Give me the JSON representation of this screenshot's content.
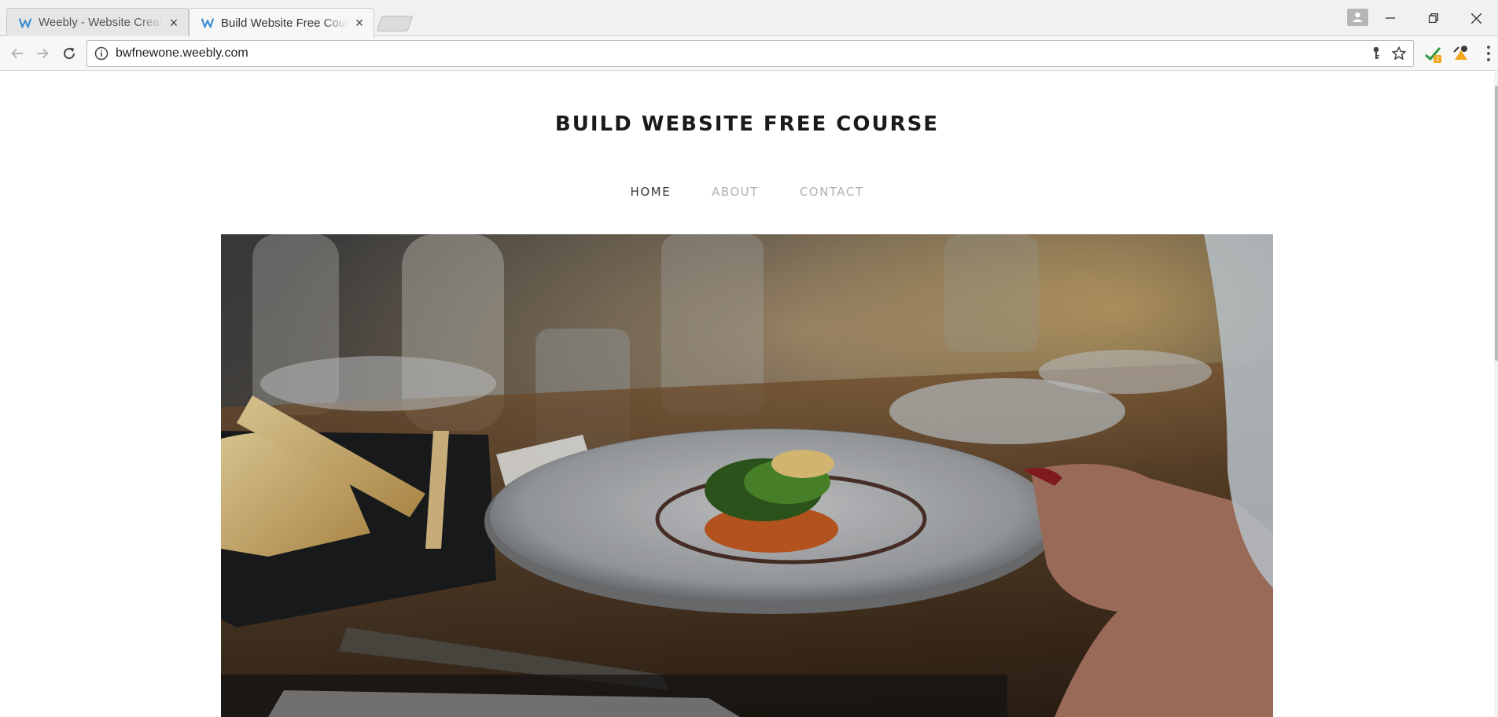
{
  "browser": {
    "tabs": [
      {
        "title": "Weebly - Website Creatio",
        "active": false
      },
      {
        "title": "Build Website Free Cours",
        "active": true
      }
    ],
    "url": "bwfnewone.weebly.com",
    "icons": {
      "back": "back-arrow-icon",
      "forward": "forward-arrow-icon",
      "reload": "reload-icon",
      "info": "info-icon",
      "key": "key-icon",
      "star": "bookmark-star-icon",
      "menu": "menu-dots-icon"
    },
    "extension_badge": "2"
  },
  "site": {
    "title": "BUILD WEBSITE FREE COURSE",
    "nav": [
      {
        "label": "HOME",
        "active": true
      },
      {
        "label": "ABOUT",
        "active": false
      },
      {
        "label": "CONTACT",
        "active": false
      }
    ]
  },
  "colors": {
    "weebly_blue": "#3d8ed4",
    "nav_active": "#3c3c3c",
    "nav_inactive": "#b0b0b0"
  }
}
